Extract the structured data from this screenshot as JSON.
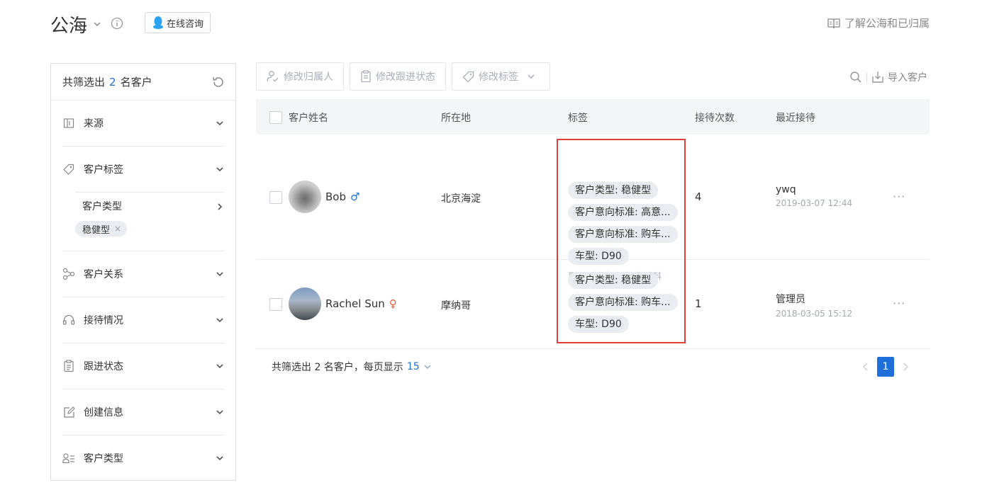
{
  "header": {
    "title": "公海",
    "consult_label": "在线咨询",
    "learn_link": "了解公海和已归属"
  },
  "sidebar": {
    "summary_prefix": "共筛选出",
    "summary_count": "2",
    "summary_suffix": "名客户",
    "sections": [
      {
        "label": "来源",
        "icon": "source-icon"
      },
      {
        "label": "客户标签",
        "icon": "tag-icon",
        "sub_label": "客户类型",
        "chip": "稳健型",
        "chip_close": "×"
      },
      {
        "label": "客户关系",
        "icon": "relation-icon"
      },
      {
        "label": "接待情况",
        "icon": "headset-icon"
      },
      {
        "label": "跟进状态",
        "icon": "clipboard-icon"
      },
      {
        "label": "创建信息",
        "icon": "edit-icon"
      },
      {
        "label": "客户类型",
        "icon": "user-list-icon"
      }
    ]
  },
  "toolbar": {
    "change_owner": "修改归属人",
    "change_status": "修改跟进状态",
    "change_tags": "修改标签",
    "import": "导入客户"
  },
  "table": {
    "columns": [
      "客户姓名",
      "所在地",
      "标签",
      "接待次数",
      "最近接待"
    ],
    "rows": [
      {
        "name": "Bob",
        "gender_symbol": "♂",
        "location": "北京海淀",
        "tags": [
          "客户类型: 稳健型",
          "客户意向标准: 高意...",
          "客户意向标准: 购车...",
          "车型: D90"
        ],
        "more_tags": "更多标签请查看用户资料",
        "visits": "4",
        "last_by": "ywq",
        "last_time": "2019-03-07 12:44",
        "more": "···"
      },
      {
        "name": "Rachel Sun",
        "gender_symbol": "♀",
        "location": "摩纳哥",
        "tags": [
          "客户类型: 稳健型",
          "客户意向标准: 购车...",
          "车型: D90"
        ],
        "visits": "1",
        "last_by": "管理员",
        "last_time": "2018-03-05 15:12",
        "more": "···"
      }
    ]
  },
  "footer": {
    "summary": "共筛选出 2 名客户，每页显示",
    "page_size": "15",
    "current_page": "1"
  },
  "colors": {
    "accent": "#1e6fd9",
    "highlight_border": "#e0403a",
    "male": "#1e6fd9",
    "female": "#e8603c"
  }
}
